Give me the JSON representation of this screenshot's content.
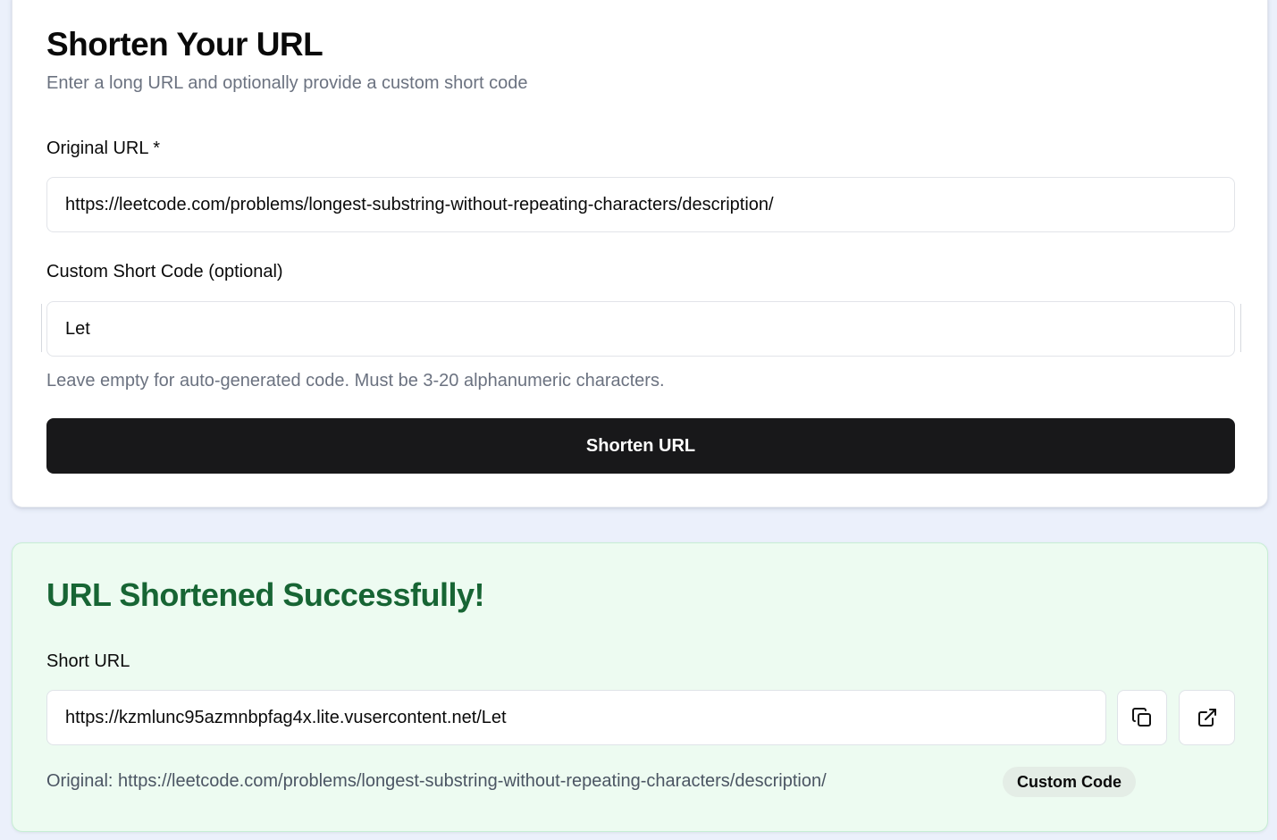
{
  "form": {
    "title": "Shorten Your URL",
    "subtitle": "Enter a long URL and optionally provide a custom short code",
    "original_url_label": "Original URL *",
    "original_url_value": "https://leetcode.com/problems/longest-substring-without-repeating-characters/description/",
    "custom_code_label": "Custom Short Code (optional)",
    "custom_code_value": "Let",
    "custom_code_hint": "Leave empty for auto-generated code. Must be 3-20 alphanumeric characters.",
    "submit_label": "Shorten URL"
  },
  "result": {
    "title": "URL Shortened Successfully!",
    "short_url_label": "Short URL",
    "short_url_value": "https://kzmlunc95azmnbpfag4x.lite.vusercontent.net/Let",
    "copy_icon": "copy-icon",
    "open_icon": "external-link-icon",
    "original_text": "Original: https://leetcode.com/problems/longest-substring-without-repeating-characters/description/",
    "badge": "Custom Code"
  },
  "colors": {
    "page_bg": "#ebf0fb",
    "primary_button": "#18181a",
    "success_title": "#176534",
    "success_bg": "#edfbf1"
  }
}
